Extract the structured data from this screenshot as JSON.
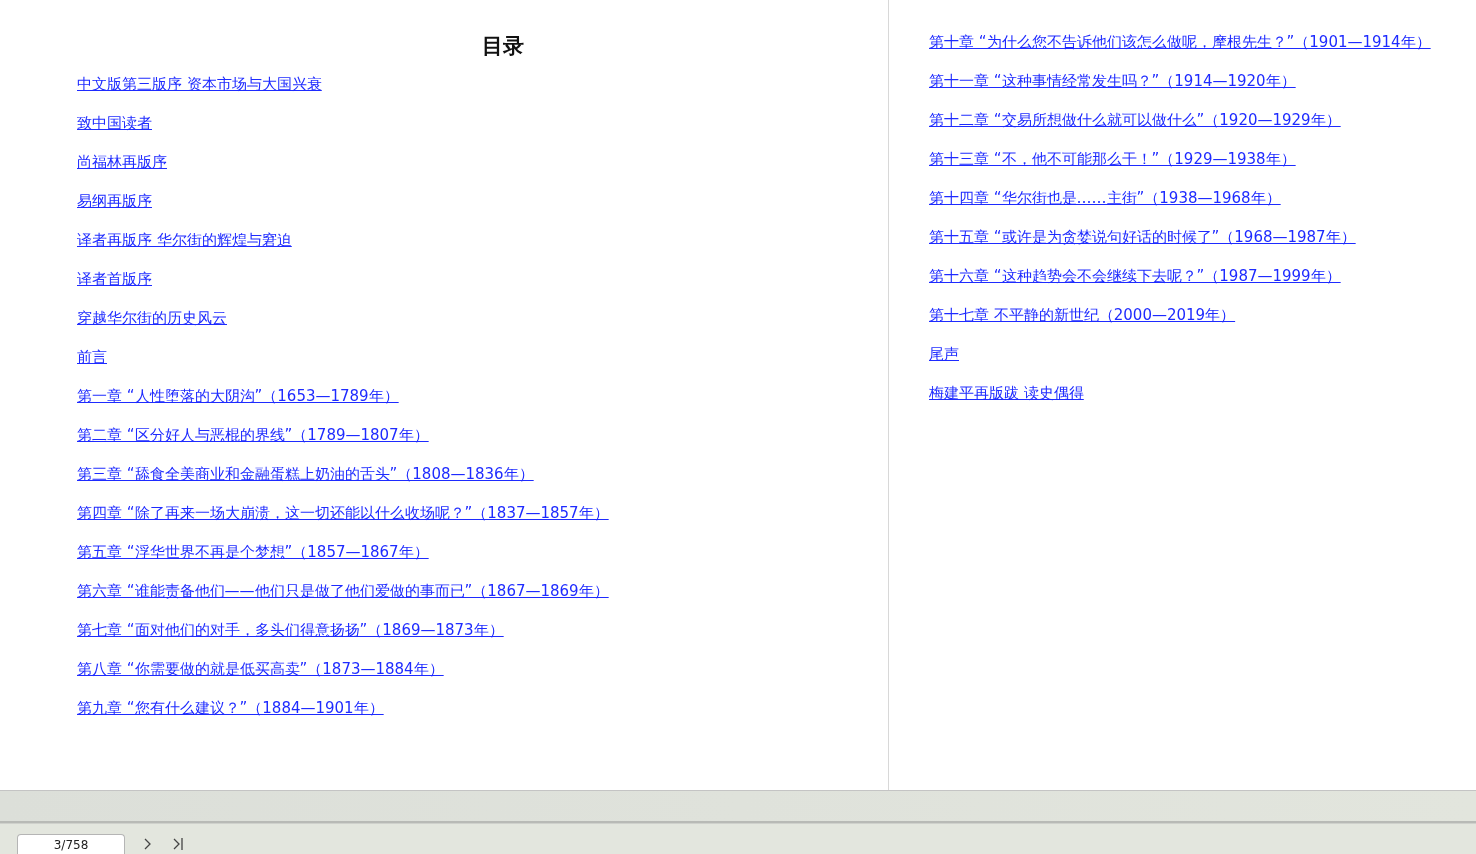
{
  "contents_title": "目录",
  "left_column": [
    "中文版第三版序 资本市场与大国兴衰",
    "致中国读者",
    "尚福林再版序",
    "易纲再版序",
    "译者再版序 华尔街的辉煌与窘迫",
    "译者首版序",
    "穿越华尔街的历史风云",
    "前言",
    "第一章 “人性堕落的大阴沟”（1653—1789年）",
    "第二章 “区分好人与恶棍的界线”（1789—1807年）",
    "第三章 “舔食全美商业和金融蛋糕上奶油的舌头”（1808—1836年）",
    "第四章 “除了再来一场大崩溃，这一切还能以什么收场呢？”（1837—1857年）",
    "第五章 “浮华世界不再是个梦想”（1857—1867年）",
    "第六章 “谁能责备他们——他们只是做了他们爱做的事而已”（1867—1869年）",
    "第七章 “面对他们的对手，多头们得意扬扬”（1869—1873年）",
    "第八章 “你需要做的就是低买高卖”（1873—1884年）",
    "第九章 “您有什么建议？”（1884—1901年）"
  ],
  "right_column": [
    "第十章 “为什么您不告诉他们该怎么做呢，摩根先生？”（1901—1914年）",
    "第十一章 “这种事情经常发生吗？”（1914—1920年）",
    "第十二章 “交易所想做什么就可以做什么”（1920—1929年）",
    "第十三章 “不，他不可能那么干！”（1929—1938年）",
    "第十四章 “华尔街也是……主街”（1938—1968年）",
    "第十五章 “或许是为贪婪说句好话的时候了”（1968—1987年）",
    "第十六章 “这种趋势会不会继续下去呢？”（1987—1999年）",
    "第十七章 不平静的新世纪（2000—2019年）",
    "尾声",
    "梅建平再版跋 读史偶得"
  ],
  "pager": {
    "page": "3/758"
  }
}
